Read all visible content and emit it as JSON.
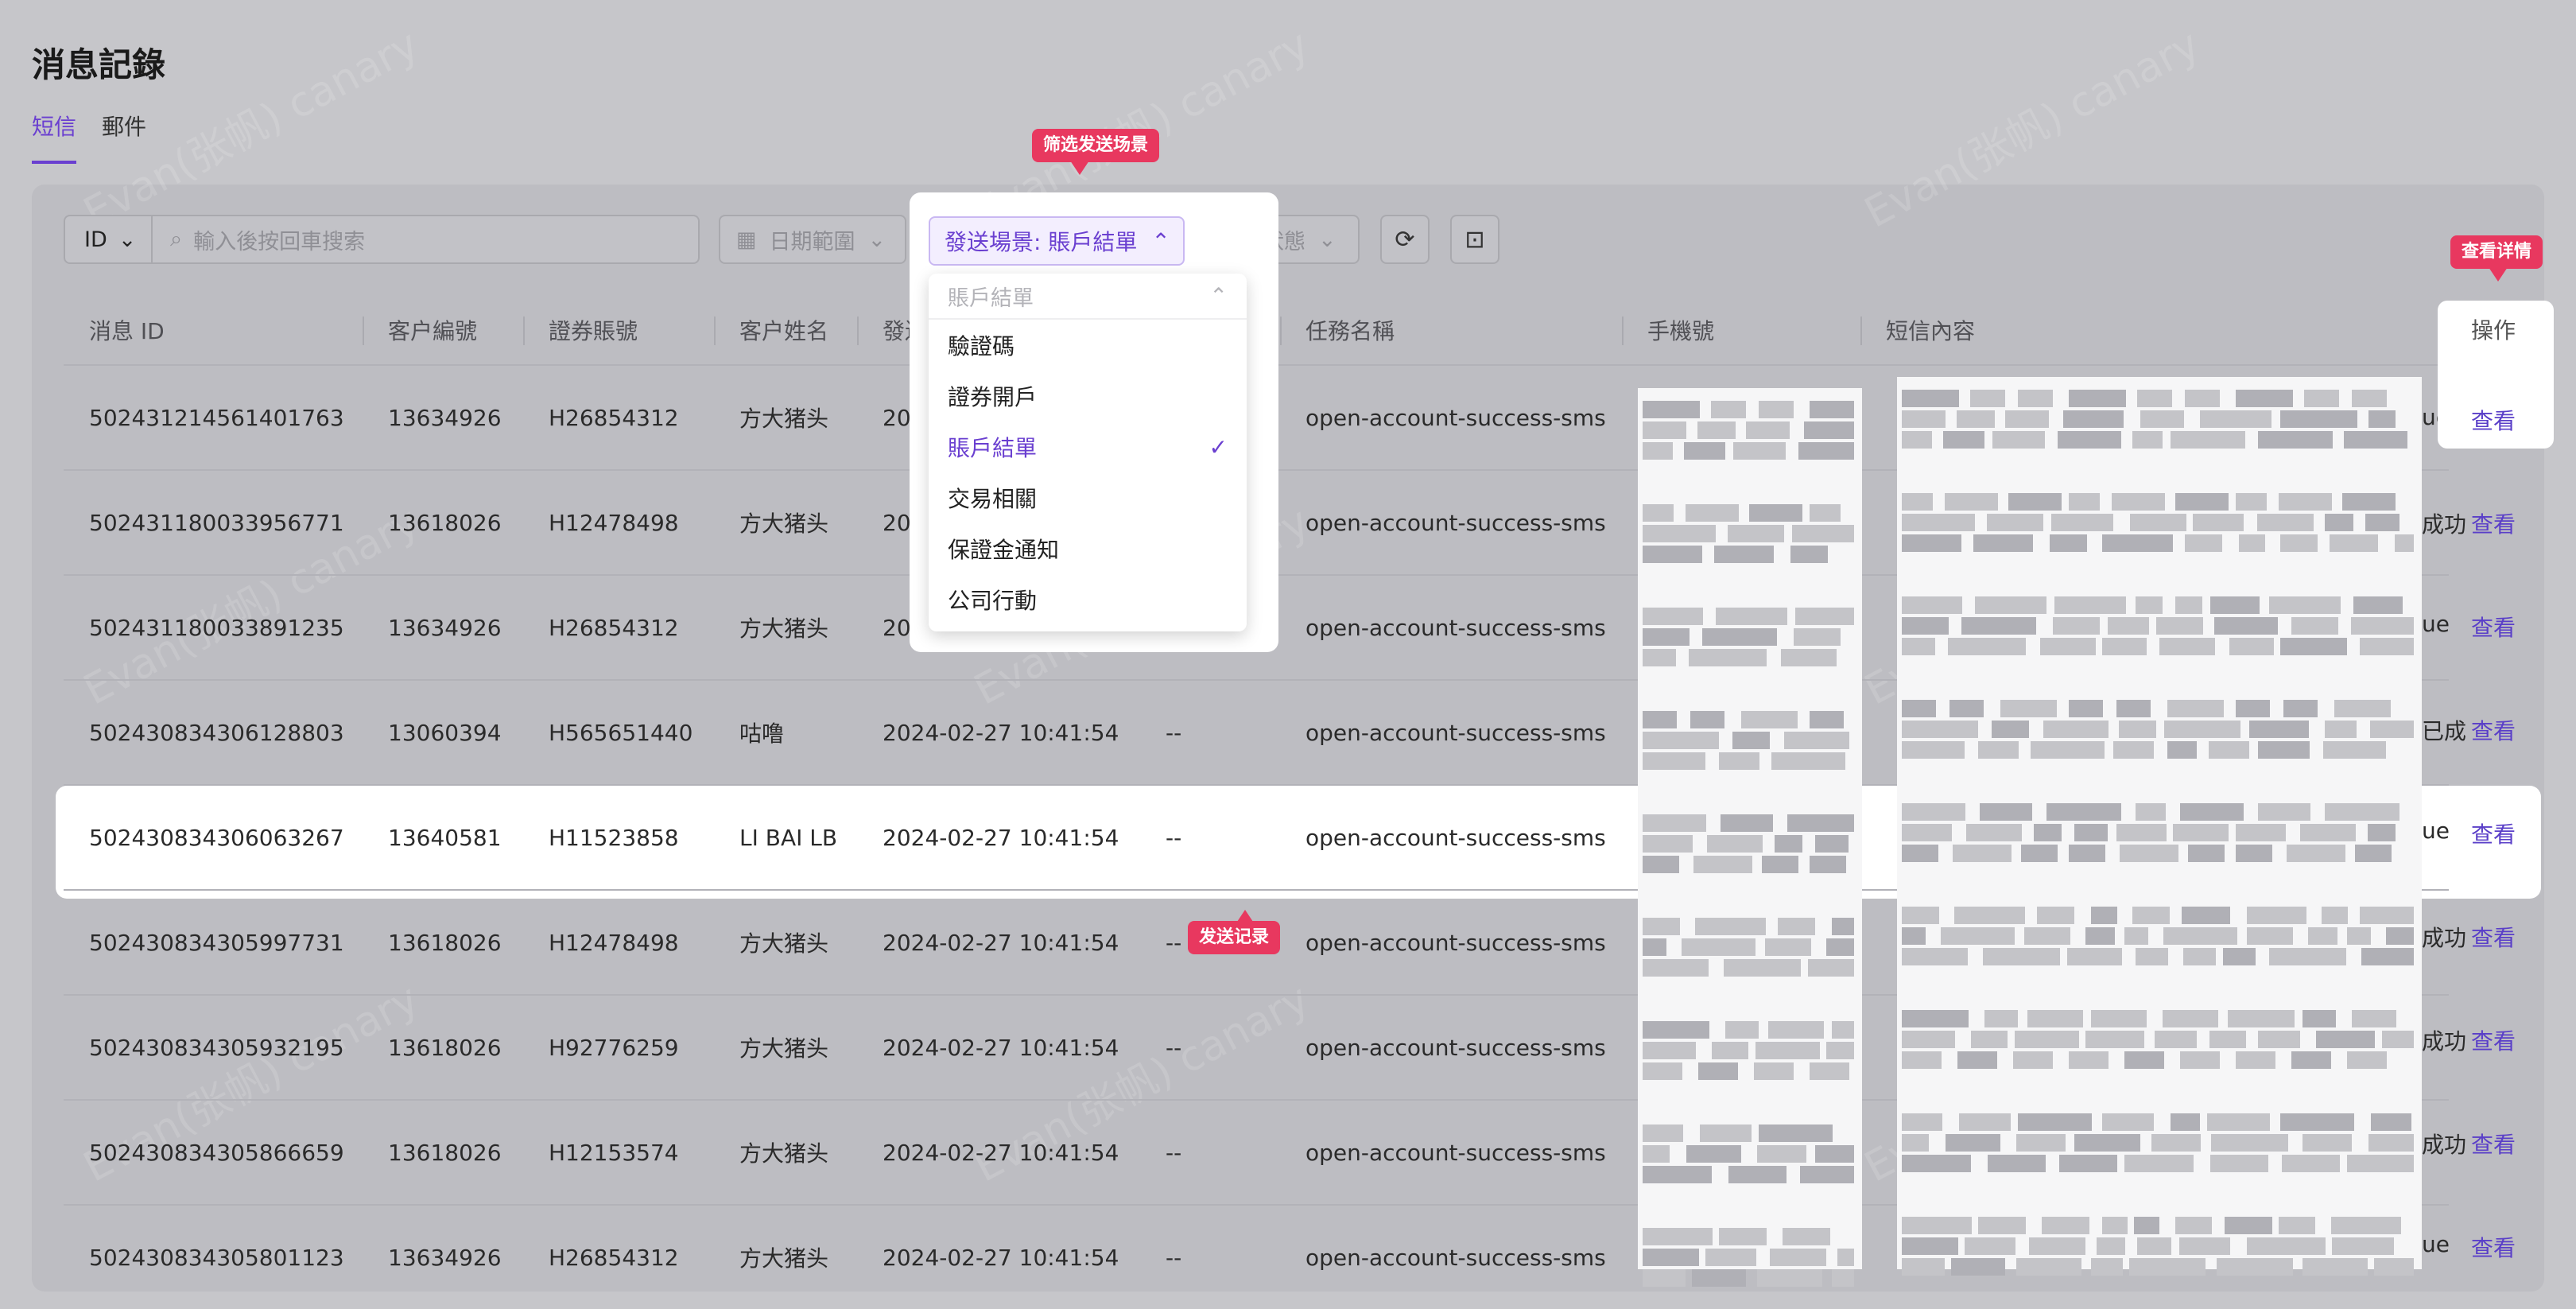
{
  "page": {
    "title": "消息記錄"
  },
  "tabs": [
    {
      "label": "短信",
      "active": true
    },
    {
      "label": "郵件",
      "active": false
    }
  ],
  "filters": {
    "id_select": "ID",
    "search_placeholder": "輸入後按回車搜索",
    "date_range": "日期範圍",
    "scene_button": "發送場景: 賬戶結單",
    "send_status": "發送狀態"
  },
  "dropdown": {
    "search_value": "賬戶結單",
    "options": [
      "驗證碼",
      "證券開戶",
      "賬戶結單",
      "交易相關",
      "保證金通知",
      "公司行動"
    ],
    "selected": "賬戶結單"
  },
  "table": {
    "headers": [
      "消息 ID",
      "客户編號",
      "證券賬號",
      "客户姓名",
      "發送",
      "--",
      "任務名稱",
      "手機號",
      "短信內容",
      "操作"
    ],
    "action_label": "查看",
    "rows": [
      {
        "msg_id": "502431214561401763",
        "customer_no": "13634926",
        "account": "H26854312",
        "name": "方大猪头",
        "time": "2024",
        "status": "",
        "task": "open-account-success-sms",
        "sms_tail": "ue"
      },
      {
        "msg_id": "502431180033956771",
        "customer_no": "13618026",
        "account": "H12478498",
        "name": "方大猪头",
        "time": "2024",
        "status": "",
        "task": "open-account-success-sms",
        "sms_tail": "成功"
      },
      {
        "msg_id": "502431180033891235",
        "customer_no": "13634926",
        "account": "H26854312",
        "name": "方大猪头",
        "time": "2024",
        "status": "",
        "task": "open-account-success-sms",
        "sms_tail": "ue"
      },
      {
        "msg_id": "502430834306128803",
        "customer_no": "13060394",
        "account": "H565651440",
        "name": "咕噜",
        "time": "2024-02-27 10:41:54",
        "status": "--",
        "task": "open-account-success-sms",
        "sms_tail": "已成"
      },
      {
        "msg_id": "502430834306063267",
        "customer_no": "13640581",
        "account": "H11523858",
        "name": "LI BAI LB",
        "time": "2024-02-27 10:41:54",
        "status": "--",
        "task": "open-account-success-sms",
        "sms_tail": "ue"
      },
      {
        "msg_id": "502430834305997731",
        "customer_no": "13618026",
        "account": "H12478498",
        "name": "方大猪头",
        "time": "2024-02-27 10:41:54",
        "status": "--",
        "task": "open-account-success-sms",
        "sms_tail": "成功"
      },
      {
        "msg_id": "502430834305932195",
        "customer_no": "13618026",
        "account": "H92776259",
        "name": "方大猪头",
        "time": "2024-02-27 10:41:54",
        "status": "--",
        "task": "open-account-success-sms",
        "sms_tail": "成功"
      },
      {
        "msg_id": "502430834305866659",
        "customer_no": "13618026",
        "account": "H12153574",
        "name": "方大猪头",
        "time": "2024-02-27 10:41:54",
        "status": "--",
        "task": "open-account-success-sms",
        "sms_tail": "成功"
      },
      {
        "msg_id": "502430834305801123",
        "customer_no": "13634926",
        "account": "H26854312",
        "name": "方大猪头",
        "time": "2024-02-27 10:41:54",
        "status": "--",
        "task": "open-account-success-sms",
        "sms_tail": "ue"
      }
    ]
  },
  "callouts": {
    "filter_scene": "筛选发送场景",
    "view_detail": "查看详情",
    "send_record": "发送记录"
  },
  "watermark": "Evan(张帆) canary",
  "colors": {
    "accent": "#6a3fd0",
    "callout": "#e8385f",
    "link": "#5a3fc8"
  }
}
